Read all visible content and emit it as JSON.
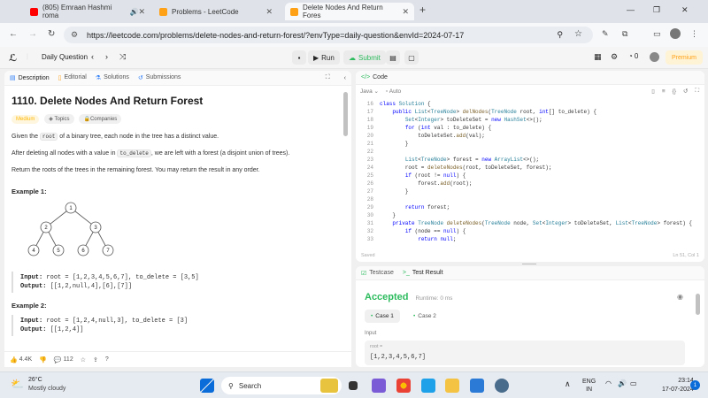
{
  "browser": {
    "tabs": [
      {
        "title": "(805) Emraan Hashmi roma",
        "icon": "youtube-icon",
        "color": "#ff0000"
      },
      {
        "title": "Problems - LeetCode",
        "icon": "leetcode-icon",
        "color": "#ffa116"
      },
      {
        "title": "Delete Nodes And Return Fores",
        "icon": "leetcode-icon",
        "color": "#ffa116"
      }
    ],
    "url": "https://leetcode.com/problems/delete-nodes-and-return-forest/?envType=daily-question&envId=2024-07-17"
  },
  "toolbar": {
    "daily_question": "Daily Question",
    "run": "Run",
    "submit": "Submit",
    "streak_count": "0",
    "premium": "Premium"
  },
  "left": {
    "tabs": [
      "Description",
      "Editorial",
      "Solutions",
      "Submissions"
    ],
    "title": "1110. Delete Nodes And Return Forest",
    "difficulty": "Medium",
    "topics": "Topics",
    "companies": "Companies",
    "p1_a": "Given the ",
    "p1_code": "root",
    "p1_b": " of a binary tree, each node in the tree has a distinct value.",
    "p2_a": "After deleting all nodes with a value in ",
    "p2_code": "to_delete",
    "p2_b": ", we are left with a forest (a disjoint union of trees).",
    "p3": "Return the roots of the trees in the remaining forest. You may return the result in any order.",
    "ex1_title": "Example 1:",
    "tree_nodes": [
      "1",
      "2",
      "3",
      "4",
      "5",
      "6",
      "7"
    ],
    "ex1_input_label": "Input:",
    "ex1_input": "root = [1,2,3,4,5,6,7], to_delete = [3,5]",
    "ex1_output_label": "Output:",
    "ex1_output": "[[1,2,null,4],[6],[7]]",
    "ex2_title": "Example 2:",
    "ex2_input_label": "Input:",
    "ex2_input": "root = [1,2,4,null,3], to_delete = [3]",
    "ex2_output_label": "Output:",
    "ex2_output": "[[1,2,4]]",
    "likes": "4.4K",
    "comments": "112"
  },
  "code": {
    "header": "Code",
    "language": "Java",
    "mode": "Auto",
    "status": "Saved",
    "cursor": "Ln 51, Col 1",
    "lines": [
      {
        "n": "16",
        "t": "class Solution {"
      },
      {
        "n": "17",
        "t": "    public List<TreeNode> delNodes(TreeNode root, int[] to_delete) {"
      },
      {
        "n": "18",
        "t": "        Set<Integer> toDeleteSet = new HashSet<>();"
      },
      {
        "n": "19",
        "t": "        for (int val : to_delete) {"
      },
      {
        "n": "20",
        "t": "            toDeleteSet.add(val);"
      },
      {
        "n": "21",
        "t": "        }"
      },
      {
        "n": "22",
        "t": ""
      },
      {
        "n": "23",
        "t": "        List<TreeNode> forest = new ArrayList<>();"
      },
      {
        "n": "24",
        "t": "        root = deleteNodes(root, toDeleteSet, forest);"
      },
      {
        "n": "25",
        "t": "        if (root != null) {"
      },
      {
        "n": "26",
        "t": "            forest.add(root);"
      },
      {
        "n": "27",
        "t": "        }"
      },
      {
        "n": "28",
        "t": ""
      },
      {
        "n": "29",
        "t": "        return forest;"
      },
      {
        "n": "30",
        "t": "    }"
      },
      {
        "n": "31",
        "t": "    private TreeNode deleteNodes(TreeNode node, Set<Integer> toDeleteSet, List<TreeNode> forest) {"
      },
      {
        "n": "32",
        "t": "        if (node == null) {"
      },
      {
        "n": "33",
        "t": "            return null;"
      }
    ]
  },
  "result": {
    "tab_testcase": "Testcase",
    "tab_result": "Test Result",
    "status": "Accepted",
    "runtime": "Runtime: 0 ms",
    "case1": "Case 1",
    "case2": "Case 2",
    "input_label": "Input",
    "var_label": "root =",
    "var_value": "[1,2,3,4,5,6,7]"
  },
  "taskbar": {
    "temp": "26°C",
    "weather": "Mostly cloudy",
    "search": "Search",
    "lang1": "ENG",
    "lang2": "IN",
    "time": "23:14",
    "date": "17-07-2024",
    "notif": "1"
  }
}
